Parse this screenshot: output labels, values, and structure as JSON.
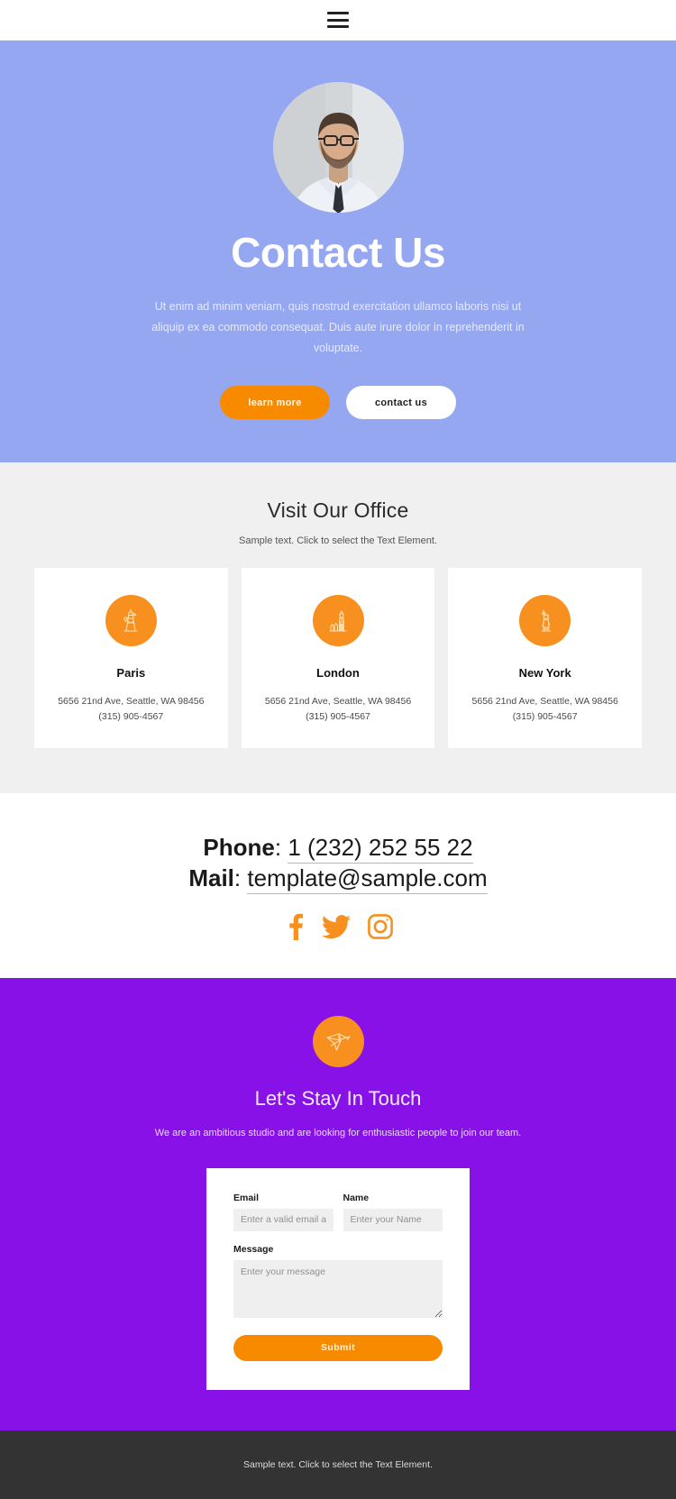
{
  "header": {
    "menu_icon": "hamburger-menu-icon"
  },
  "hero": {
    "avatar_alt": "man-with-glasses-portrait",
    "title": "Contact Us",
    "subtitle": "Ut enim ad minim veniam, quis nostrud exercitation ullamco laboris nisi ut aliquip ex ea commodo consequat. Duis aute irure dolor in reprehenderit in voluptate.",
    "buttons": [
      {
        "label": "learn more",
        "style": "primary"
      },
      {
        "label": "contact us",
        "style": "ghost"
      }
    ],
    "bg_color": "#96a7f2"
  },
  "offices": {
    "title": "Visit Our Office",
    "subtitle": "Sample text. Click to select the Text Element.",
    "bg_color": "#f0f0f0",
    "accent_color": "#f7901e",
    "cards": [
      {
        "icon": "eiffel-tower-icon",
        "name": "Paris",
        "address": "5656 21nd Ave, Seattle, WA 98456",
        "phone": "(315) 905-4567"
      },
      {
        "icon": "big-ben-icon",
        "name": "London",
        "address": "5656 21nd Ave, Seattle, WA 98456",
        "phone": "(315) 905-4567"
      },
      {
        "icon": "statue-of-liberty-icon",
        "name": "New York",
        "address": "5656 21nd Ave, Seattle, WA 98456",
        "phone": "(315) 905-4567"
      }
    ]
  },
  "contact_info": {
    "phone_label": "Phone",
    "phone_value": "1 (232) 252 55 22",
    "mail_label": "Mail",
    "mail_value": "template@sample.com",
    "separator": ":",
    "socials": [
      {
        "icon": "facebook-icon",
        "name": "Facebook"
      },
      {
        "icon": "twitter-icon",
        "name": "Twitter"
      },
      {
        "icon": "instagram-icon",
        "name": "Instagram"
      }
    ],
    "social_color": "#f7901e"
  },
  "touch": {
    "icon": "origami-bird-icon",
    "title": "Let's Stay In Touch",
    "subtitle": "We are an ambitious studio and are looking for enthusiastic people to join our team.",
    "bg_color": "#8811e8",
    "form": {
      "email_label": "Email",
      "email_placeholder": "Enter a valid email add",
      "email_value": "",
      "name_label": "Name",
      "name_placeholder": "Enter your Name",
      "name_value": "",
      "message_label": "Message",
      "message_placeholder": "Enter your message",
      "message_value": "",
      "submit_label": "Submit"
    }
  },
  "footer": {
    "text": "Sample text. Click to select the Text Element.",
    "bg_color": "#333333"
  }
}
